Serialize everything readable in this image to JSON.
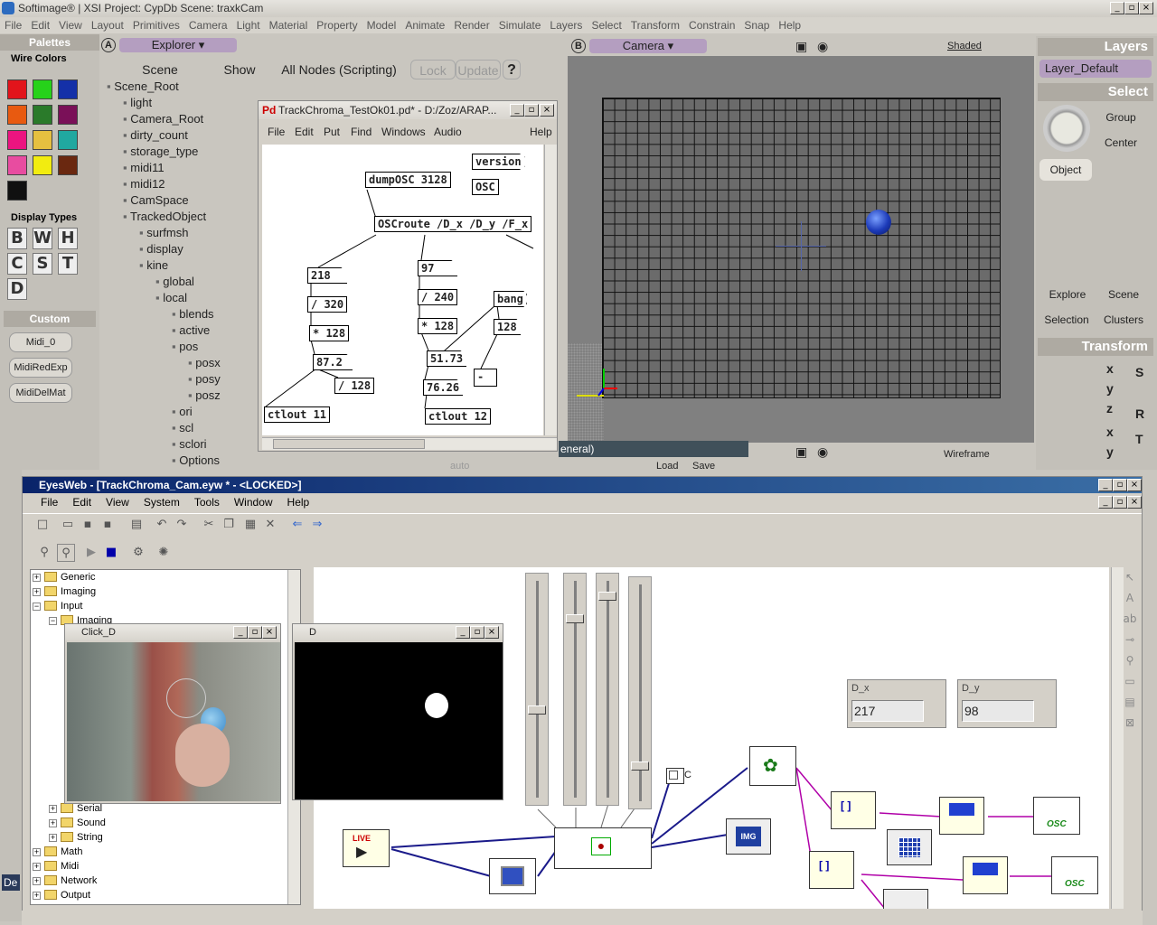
{
  "softimage": {
    "title": "Softimage® | XSI Project: CypDb    Scene: traxkCam",
    "menu": [
      "File",
      "Edit",
      "View",
      "Layout",
      "Primitives",
      "Camera",
      "Light",
      "Material",
      "Property",
      "Model",
      "Animate",
      "Render",
      "Simulate",
      "Layers",
      "Select",
      "Transform",
      "Constrain",
      "Snap",
      "Help"
    ],
    "palettes": {
      "title": "Palettes",
      "wire_colors": "Wire Colors",
      "colors": [
        "#e2141b",
        "#26d21a",
        "#1430a8",
        "#e85a10",
        "#2a7a2a",
        "#7a1058",
        "#ec1480",
        "#e6c040",
        "#20a8a0",
        "#e84ca0",
        "#f2ec10",
        "#6a2810",
        "#101010"
      ],
      "display_types_title": "Display Types",
      "display_types": [
        "B",
        "W",
        "H",
        "C",
        "S",
        "T",
        "D"
      ],
      "custom_title": "Custom",
      "custom_buttons": [
        "Midi_0",
        "MidiRedExp",
        "MidiDelMat"
      ]
    },
    "explorer": {
      "badge": "A",
      "title": "Explorer",
      "scene_btn": "Scene",
      "show_btn": "Show",
      "all_nodes": "All Nodes (Scripting)",
      "lock": "Lock",
      "update": "Update",
      "help": "?",
      "tree": [
        "Scene_Root",
        "light",
        "Camera_Root",
        "dirty_count",
        "storage_type",
        "midi11",
        "midi12",
        "CamSpace",
        "TrackedObject",
        "surfmsh",
        "display",
        "kine",
        "global",
        "local",
        "blends",
        "active",
        "pos",
        "posx",
        "posy",
        "posz",
        "ori",
        "scl",
        "sclori",
        "Options"
      ]
    },
    "camera": {
      "badge": "B",
      "title": "Camera",
      "mode": "Shaded",
      "bottom_mode": "Wireframe",
      "bottom_title_partial": "eneral)",
      "bottom_auto": "auto",
      "bottom_load": "Load",
      "bottom_save": "Save"
    },
    "right_panel": {
      "layers_title": "Layers",
      "layer_value": "Layer_Default",
      "select_title": "Select",
      "group": "Group",
      "center": "Center",
      "object": "Object",
      "explore": "Explore",
      "scene": "Scene",
      "selection": "Selection",
      "clusters": "Clusters",
      "transform_title": "Transform",
      "axes": [
        "x",
        "y",
        "z",
        "x",
        "y"
      ],
      "transform_icons": [
        "S",
        "R",
        "T"
      ]
    }
  },
  "pd": {
    "title": "TrackChroma_TestOk01.pd* - D:/Zoz/ARAP...",
    "menu": [
      "File",
      "Edit",
      "Put",
      "Find",
      "Windows",
      "Audio",
      "Help"
    ],
    "boxes": {
      "version": "version",
      "osc": "OSC",
      "dumposc": "dumpOSC 3128",
      "oscroute": "OSCroute /D_x /D_y /F_x",
      "n218": "218",
      "div320": "/ 320",
      "mul128a": "* 128",
      "n872": "87.2",
      "div128": "/ 128",
      "ctlout11": "ctlout 11",
      "n97": "97",
      "div240": "/ 240",
      "mul128b": "* 128",
      "n5173": "51.73",
      "bang": "bang",
      "n128": "128",
      "minus": "-",
      "n7626": "76.26",
      "ctlout12": "ctlout 12"
    }
  },
  "eyesweb": {
    "title": "EyesWeb - [TrackChroma_Cam.eyw * - <LOCKED>]",
    "menu": [
      "File",
      "Edit",
      "View",
      "System",
      "Tools",
      "Window",
      "Help"
    ],
    "tree_top": [
      "Generic",
      "Imaging",
      "Input",
      "Imaging"
    ],
    "tree_bottom": [
      "Serial",
      "Sound",
      "String",
      "Math",
      "Midi",
      "Network",
      "Output"
    ],
    "click_window_title": "Click_D",
    "d_window_title": "D",
    "dx_label": "D_x",
    "dx_value": "217",
    "dy_label": "D_y",
    "dy_value": "98",
    "slider_levels": [
      0.6,
      0.16,
      0.05,
      0.85
    ],
    "live_label": "LIVE",
    "img_label": "IMG",
    "osc_label": "OSC",
    "checkbox_label": "C"
  },
  "partial": {
    "de": "De"
  }
}
